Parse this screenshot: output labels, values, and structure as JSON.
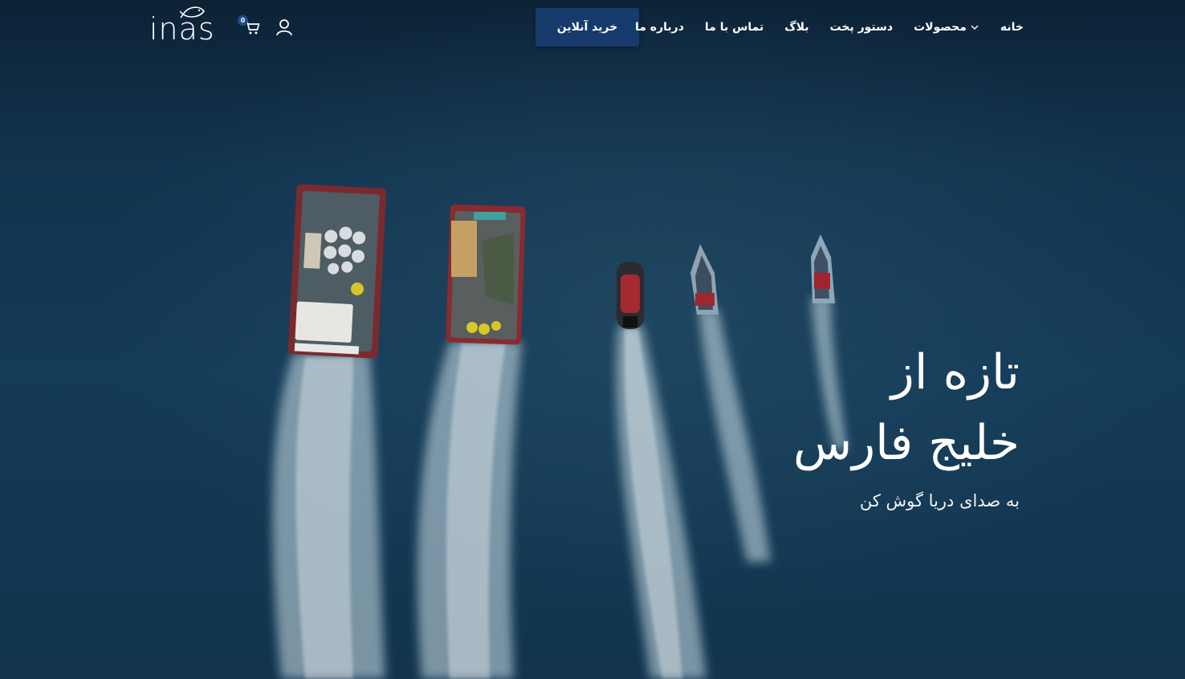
{
  "brand": {
    "logo_text": "inas"
  },
  "header": {
    "cart_count": "0",
    "buy_button": "خرید آنلاین",
    "menu": [
      {
        "label": "خانه"
      },
      {
        "label": "محصولات",
        "has_dropdown": true
      },
      {
        "label": "دستور پخت"
      },
      {
        "label": "بلاگ"
      },
      {
        "label": "تماس با ما"
      },
      {
        "label": "درباره ما"
      }
    ]
  },
  "hero": {
    "title_line1": "تازه از",
    "title_line2": "خلیج فارس",
    "subtitle": "به صدای دریا گوش کن"
  },
  "colors": {
    "button_bg": "#173b6c",
    "sea": "#143b57",
    "text": "#ffffff"
  },
  "icons": [
    "fish-logo-icon",
    "cart-icon",
    "user-icon",
    "chevron-down-icon"
  ]
}
